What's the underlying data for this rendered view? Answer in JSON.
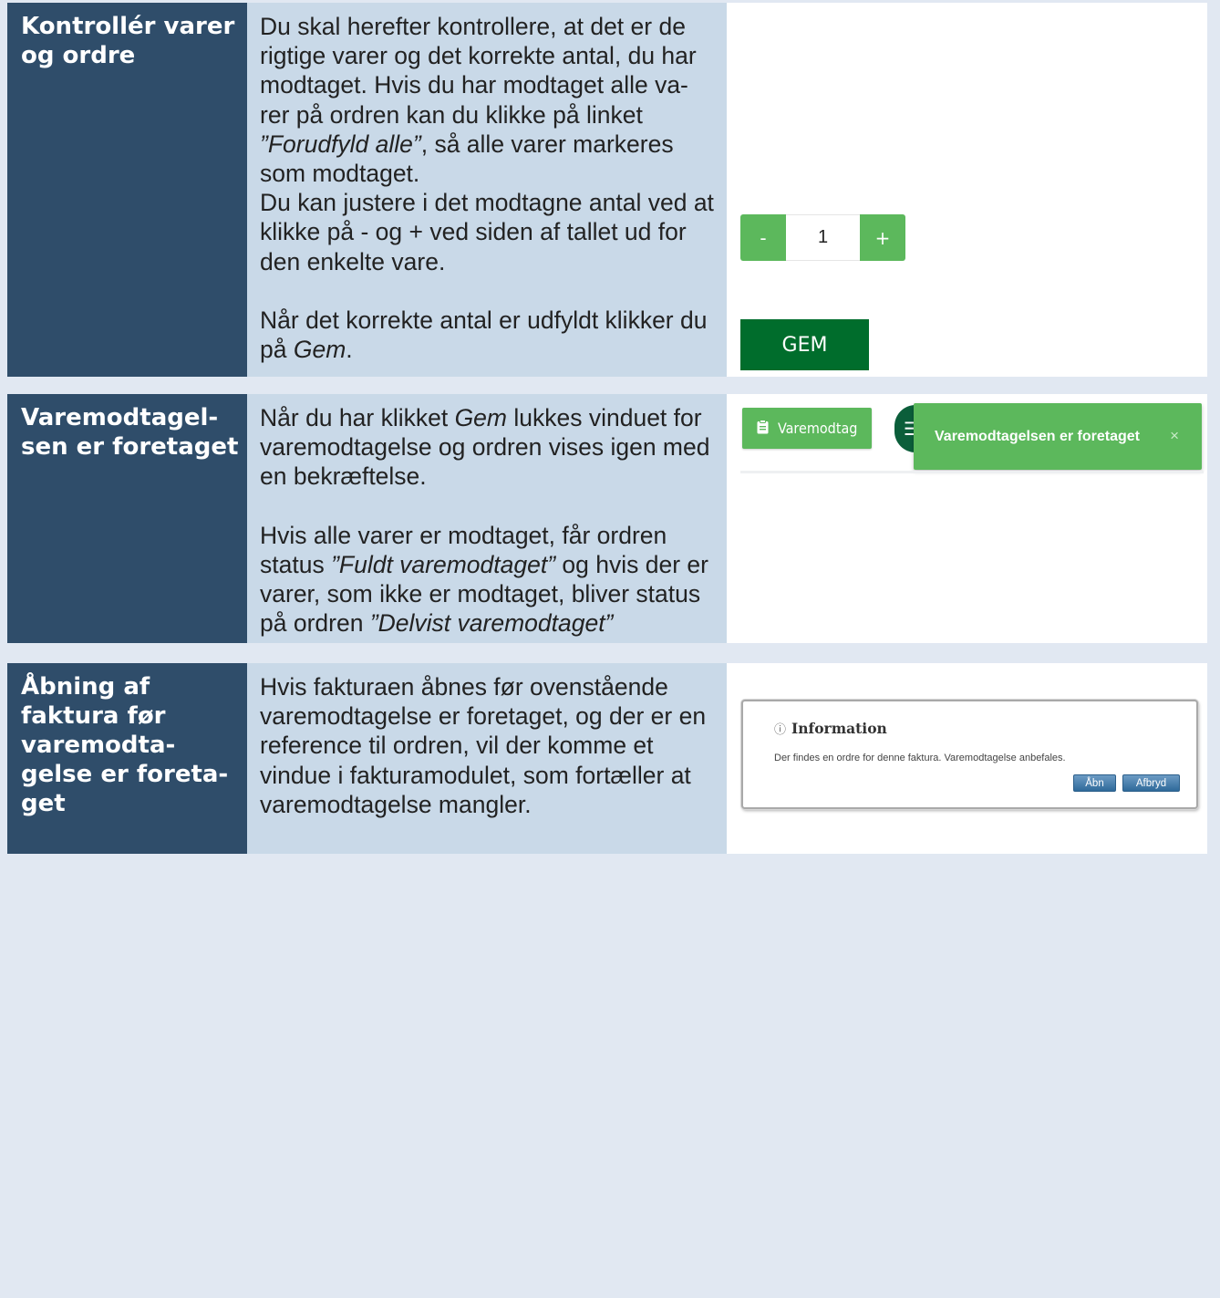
{
  "rows": [
    {
      "title": "Kontrollér varer og ordre",
      "text": {
        "p1_a": "Du skal herefter kontrollere, at det er de rigtige varer og det korrekte antal, du har modtaget. Hvis du har modtaget alle va-rer på ordren kan du klikke på linket ",
        "p1_em": "”Forudfyld alle”",
        "p1_b": ", så alle varer markeres som modtaget.",
        "p2": "Du kan justere i det modtagne antal ved at klikke på - og + ved siden af tallet ud for den enkelte vare.",
        "p3_a": "Når det korrekte antal er udfyldt klikker du på ",
        "p3_em": "Gem",
        "p3_b": "."
      },
      "image": {
        "minus_label": "-",
        "quantity": "1",
        "plus_label": "+",
        "gem_label": "GEM"
      }
    },
    {
      "title": "Varemodtagel-sen er foretaget",
      "text": {
        "p1_a": "Når du har klikket ",
        "p1_em": "Gem",
        "p1_b": " lukkes vinduet for varemodtagelse og ordren vises igen med en bekræftelse.",
        "p2_a": "Hvis alle varer er modtaget, får ordren status ",
        "p2_em1": "”Fuldt varemodtaget”",
        "p2_b": " og hvis der er varer, som ikke er modtaget, bliver status på ordren ",
        "p2_em2": "”Delvist varemodtaget”"
      },
      "image": {
        "varemodtag_label": "Varemodtag",
        "toast_text": "Varemodtagelsen er foretaget",
        "close_symbol": "×",
        "menu_symbol": "☰"
      }
    },
    {
      "title": "Åbning af faktura før varemodta-gelse er foreta-get",
      "text": {
        "p1": "Hvis fakturaen åbnes før ovenstående varemodtagelse er foretaget, og der er en reference til ordren, vil der komme et vindue i fakturamodulet, som fortæller at varemodtagelse mangler."
      },
      "image": {
        "dialog_title": "Information",
        "dialog_message": "Der findes en ordre for denne faktura. Varemodtagelse anbefales.",
        "open_label": "Åbn",
        "cancel_label": "Afbryd"
      }
    }
  ],
  "colors": {
    "page_bg": "#e1e8f2",
    "title_bg": "#2f4d6a",
    "text_bg": "#c9d9e8",
    "green": "#5cb85c",
    "dark_green": "#006d2c"
  }
}
